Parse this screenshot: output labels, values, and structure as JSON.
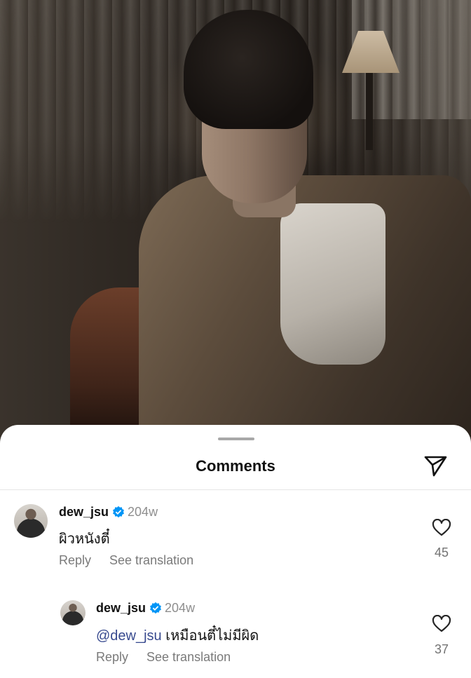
{
  "sheet": {
    "title": "Comments",
    "share_icon": "send-icon"
  },
  "comments": [
    {
      "username": "dew_jsu",
      "verified": true,
      "time": "204w",
      "text": "ผิวหนังตี๋",
      "reply_label": "Reply",
      "translate_label": "See translation",
      "likes": "45"
    },
    {
      "username": "dew_jsu",
      "verified": true,
      "time": "204w",
      "mention": "@dew_jsu",
      "text": " เหมือนตี๋ไม่มีผิด",
      "reply_label": "Reply",
      "translate_label": "See translation",
      "likes": "37"
    }
  ],
  "colors": {
    "verified": "#0095f6",
    "mention": "#384a8f",
    "muted": "#7a7a7a"
  }
}
